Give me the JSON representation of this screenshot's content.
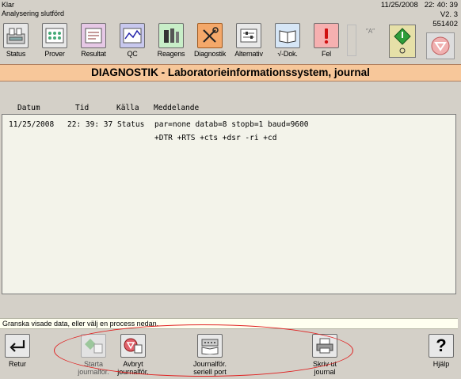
{
  "status": {
    "line1": "Klar",
    "line2": "Analysering slutförd"
  },
  "info": {
    "date": "11/25/2008",
    "time": "22: 40: 39",
    "version": "V2. 3",
    "serial": "551402"
  },
  "toolbar": [
    {
      "label": "Status",
      "icon": "status-icon"
    },
    {
      "label": "Prover",
      "icon": "samples-icon"
    },
    {
      "label": "Resultat",
      "icon": "results-icon"
    },
    {
      "label": "QC",
      "icon": "qc-chart-icon"
    },
    {
      "label": "Reagens",
      "icon": "reagents-icon"
    },
    {
      "label": "Diagnostik",
      "icon": "diagnostics-tools-icon",
      "active": true
    },
    {
      "label": "Alternativ",
      "icon": "options-icon"
    },
    {
      "label": "√-Dok.",
      "icon": "document-book-icon"
    },
    {
      "label": "Fel",
      "icon": "error-exclamation-icon"
    }
  ],
  "title": "DIAGNOSTIK - Laboratorieinformationssystem, journal",
  "journal": {
    "columns": [
      "Datum",
      "Tid",
      "Källa",
      "Meddelande"
    ],
    "rows": [
      {
        "date": "11/25/2008",
        "time": "22: 39: 37",
        "source": "Status",
        "message": "par=none datab=8 stopb=1 baud=9600",
        "message2": "+DTR +RTS +cts +dsr -ri +cd"
      }
    ]
  },
  "prompt": "Granska visade data, eller välj en process nedan.",
  "bottom_buttons": [
    {
      "label": "Retur",
      "icon": "return-arrow-icon"
    },
    {
      "label": "Starta\njournalför.",
      "icon": "start-logging-icon",
      "disabled": true
    },
    {
      "label": "Avbryt\njournalför.",
      "icon": "stop-logging-icon"
    },
    {
      "label": "Journalför.\nseriell port",
      "icon": "serial-port-log-icon"
    },
    {
      "label": "Skriv ut\njournal",
      "icon": "printer-icon"
    },
    {
      "label": "Hjälp",
      "icon": "help-question-icon"
    }
  ],
  "colors": {
    "title_bar": "#f7c79a",
    "active_tab": "#f4a86a",
    "annotation": "#e02020",
    "go_button": "#2e9e3a",
    "stop_button": "#e0606a"
  }
}
